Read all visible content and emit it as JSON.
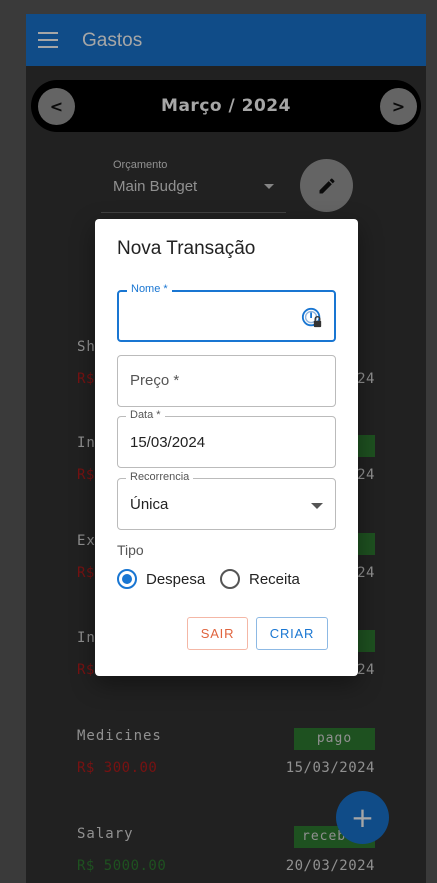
{
  "app": {
    "title": "Gastos"
  },
  "month_nav": {
    "prev_label": "<",
    "next_label": ">",
    "month": "Março / 2024"
  },
  "budget": {
    "label": "Orçamento",
    "value": "Main Budget"
  },
  "transactions": [
    {
      "name": "Sh",
      "amount": "R$",
      "badge": "",
      "date": "024",
      "kind": "exp"
    },
    {
      "name": "Int",
      "amount": "R$",
      "badge": "",
      "date": "024",
      "kind": "exp"
    },
    {
      "name": "Exp",
      "amount": "R$",
      "badge": "",
      "date": "024",
      "kind": "exp"
    },
    {
      "name": "Inv",
      "amount": "R$",
      "badge": "",
      "date": "024",
      "kind": "exp"
    },
    {
      "name": "Medicines",
      "amount": "R$ 300.00",
      "badge": "pago",
      "date": "15/03/2024",
      "kind": "exp"
    },
    {
      "name": "Salary",
      "amount": "R$ 5000.00",
      "badge": "receb",
      "date": "20/03/2024",
      "kind": "inc"
    }
  ],
  "fab": {
    "label": "+"
  },
  "dialog": {
    "title": "Nova Transação",
    "nome": {
      "label": "Nome *",
      "value": ""
    },
    "preco": {
      "placeholder": "Preço *"
    },
    "data": {
      "label": "Data *",
      "value": "15/03/2024"
    },
    "recorrencia": {
      "label": "Recorrencia",
      "value": "Única"
    },
    "tipo": {
      "label": "Tipo",
      "options": [
        "Despesa",
        "Receita"
      ],
      "selected": "Despesa"
    },
    "buttons": {
      "sair": "SAIR",
      "criar": "CRIAR"
    }
  },
  "colors": {
    "primary": "#1976d2",
    "expense": "#b71c1c",
    "income": "#2e7d32",
    "cancel": "#e0643e"
  }
}
